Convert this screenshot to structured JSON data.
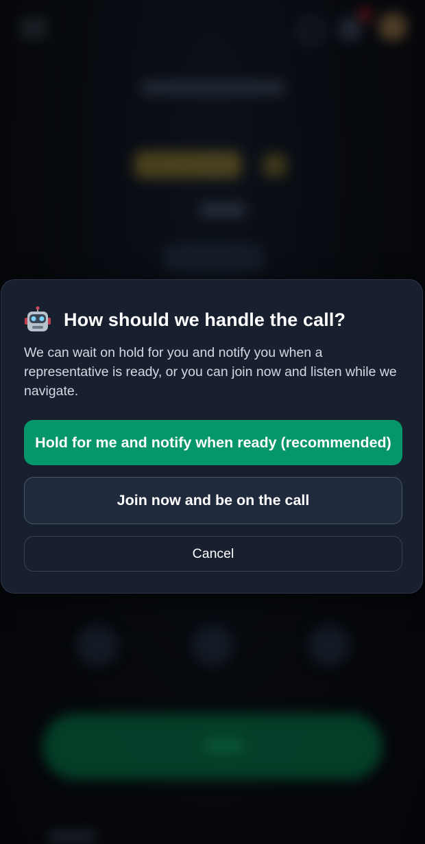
{
  "dialog": {
    "title": "How should we handle the call?",
    "body": "We can wait on hold for you and notify you when a representative is ready, or you can join now and listen while we navigate.",
    "icon": "robot-icon",
    "buttons": {
      "hold_label": "Hold for me and notify when ready (recommended)",
      "join_label": "Join now and be on the call",
      "cancel_label": "Cancel"
    }
  },
  "colors": {
    "primary": "#059669",
    "dialog_bg": "#182030",
    "page_bg": "#05070b"
  }
}
